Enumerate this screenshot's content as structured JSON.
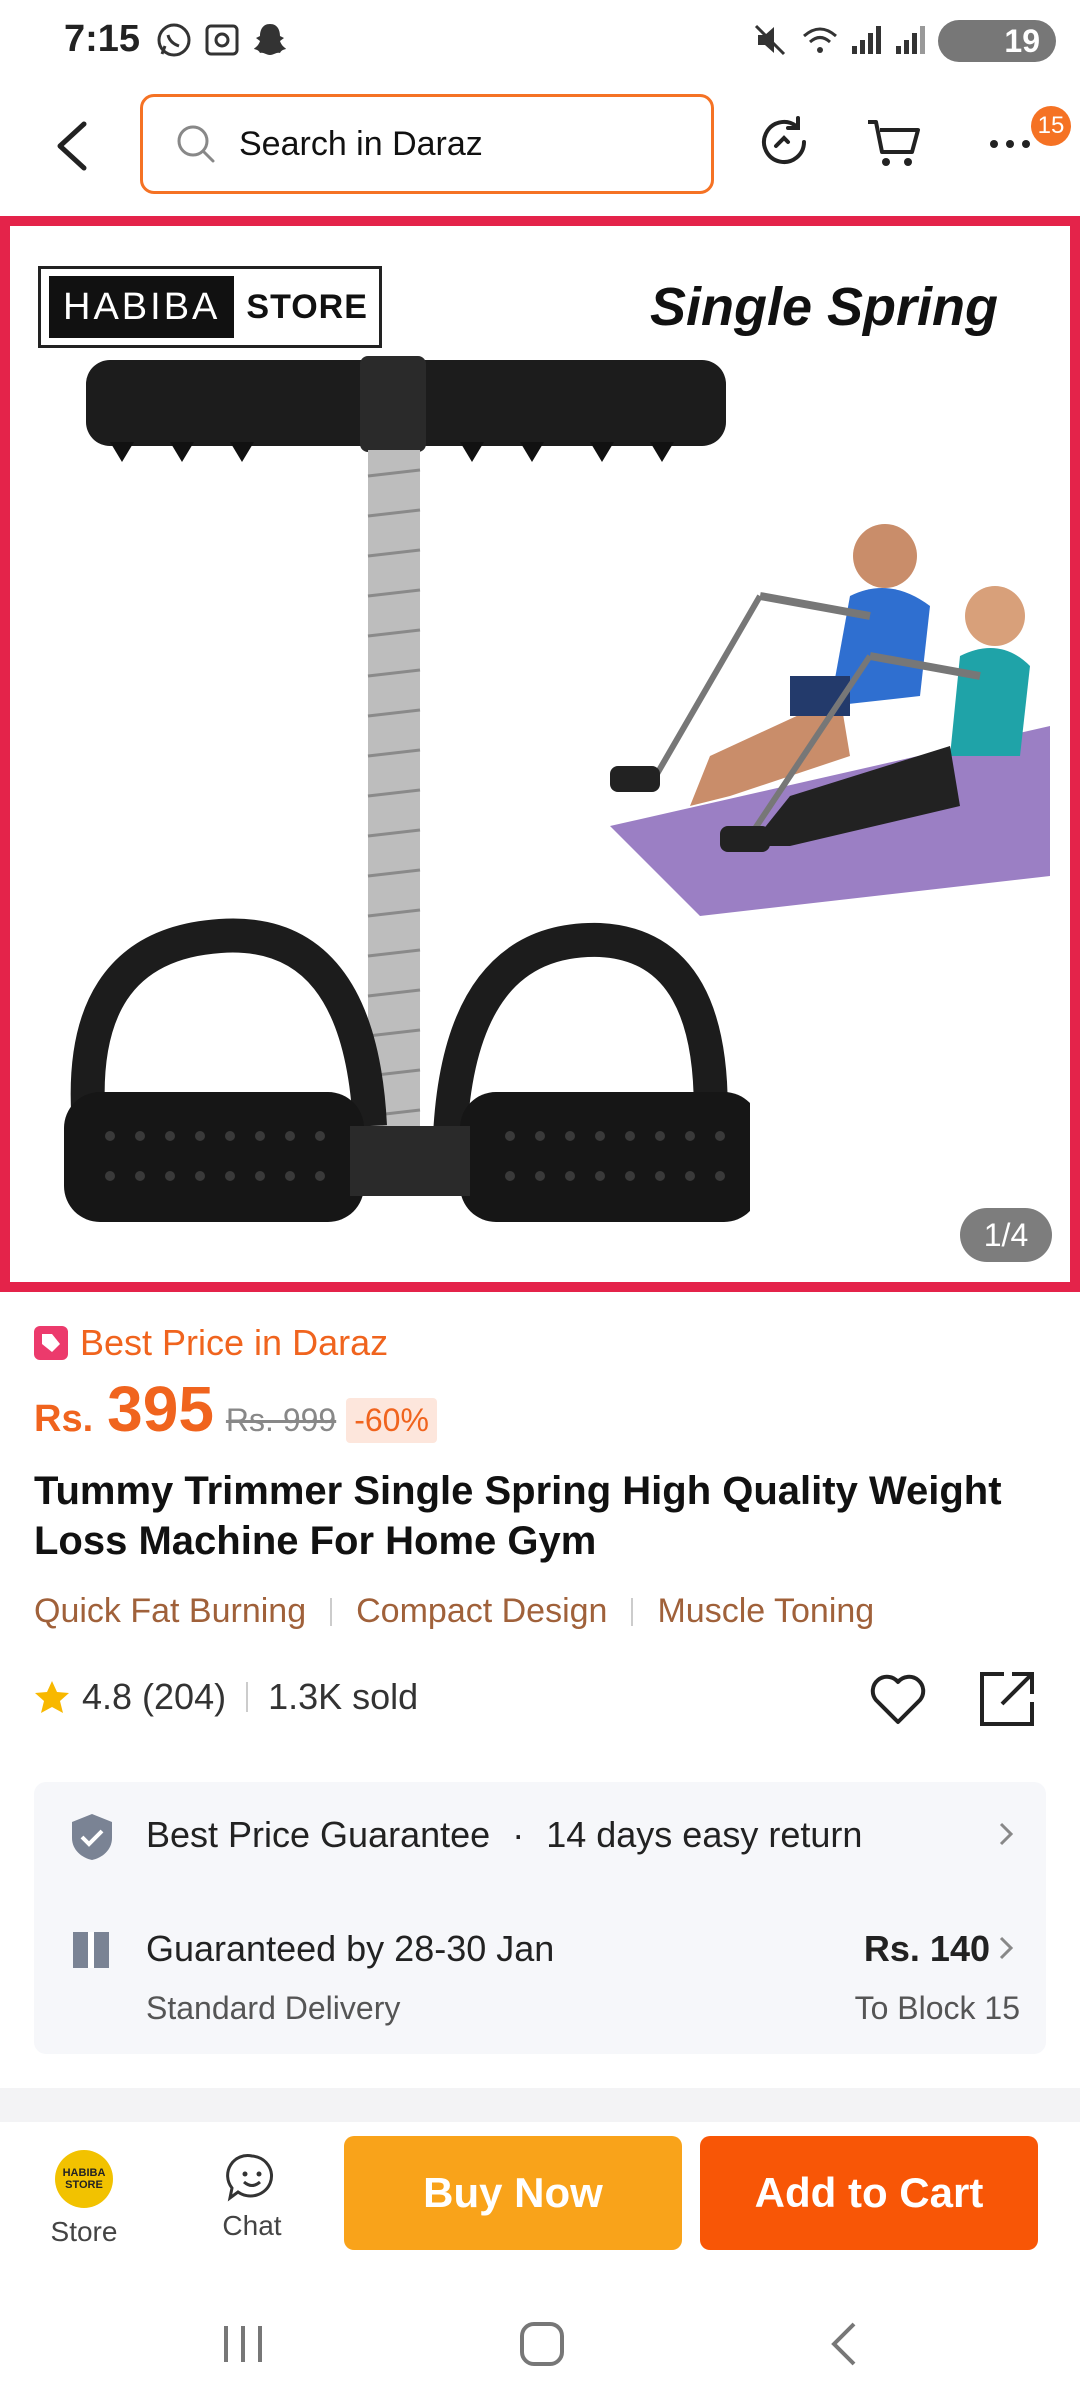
{
  "status_bar": {
    "time": "7:15",
    "battery": "19"
  },
  "header": {
    "search_placeholder": "Search in Daraz",
    "more_badge": "15"
  },
  "gallery": {
    "store_logo_dark": "HABIBA",
    "store_logo_light": "STORE",
    "headline": "Single Spring",
    "counter": "1/4"
  },
  "product": {
    "best_price_label": "Best Price in Daraz",
    "currency": "Rs.",
    "price": "395",
    "original_price": "Rs. 999",
    "discount": "-60%",
    "title": "Tummy Trimmer Single Spring High Quality Weight Loss Machine For Home Gym",
    "features": [
      "Quick Fat Burning",
      "Compact Design",
      "Muscle Toning"
    ],
    "rating": "4.8",
    "reviews": "(204)",
    "sold": "1.3K sold"
  },
  "services": {
    "guarantee": "Best Price Guarantee",
    "return_policy": "14 days easy return",
    "delivery": "Guaranteed by 28-30 Jan",
    "delivery_type": "Standard Delivery",
    "fee": "Rs. 140",
    "destination": "To Block 15"
  },
  "action_bar": {
    "store_label": "Store",
    "store_logo_text": "HABIBA STORE",
    "chat_label": "Chat",
    "buy_now": "Buy Now",
    "add_to_cart": "Add to Cart"
  },
  "colors": {
    "accent": "#f57224",
    "buy_now": "#f9a31a",
    "add_to_cart": "#f85606",
    "gallery_border": "#e4234a",
    "feature_text": "#a0613a"
  }
}
